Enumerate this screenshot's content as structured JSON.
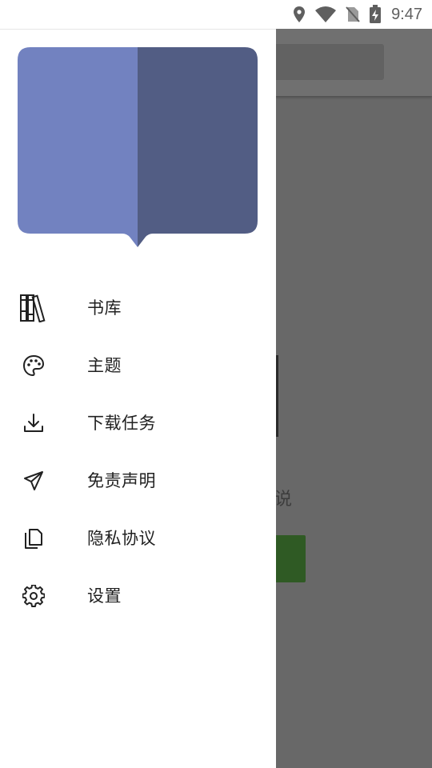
{
  "status_bar": {
    "time": "9:47",
    "icons": [
      "location-icon",
      "wifi-icon",
      "no-sim-icon",
      "battery-charging-icon"
    ]
  },
  "drawer": {
    "header_art": "open-book-icon",
    "colors": {
      "book_left": "#7282C0",
      "book_right": "#525D84"
    },
    "items": [
      {
        "label": "书库",
        "icon": "library-icon"
      },
      {
        "label": "主题",
        "icon": "palette-icon"
      },
      {
        "label": "下载任务",
        "icon": "download-icon"
      },
      {
        "label": "免责声明",
        "icon": "paper-plane-icon"
      },
      {
        "label": "隐私协议",
        "icon": "copy-document-icon"
      },
      {
        "label": "设置",
        "icon": "settings-gear-icon"
      }
    ]
  },
  "background": {
    "partial_text": "说",
    "accent_green": "#2F5A24"
  }
}
